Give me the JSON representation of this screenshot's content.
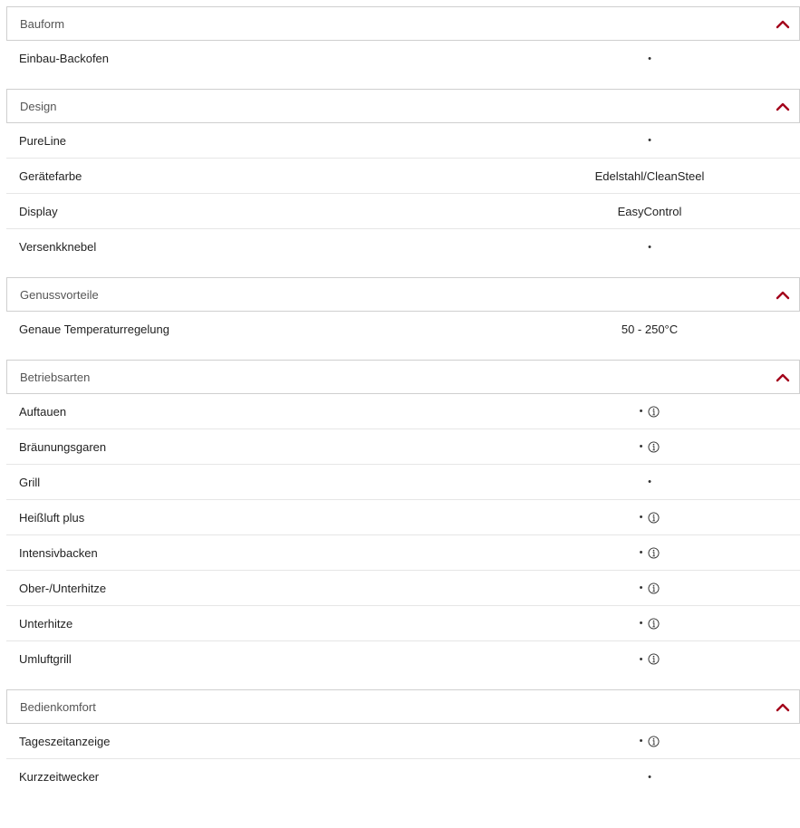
{
  "sections": [
    {
      "title": "Bauform",
      "rows": [
        {
          "label": "Einbau-Backofen",
          "value": "•",
          "info": false
        }
      ]
    },
    {
      "title": "Design",
      "rows": [
        {
          "label": "PureLine",
          "value": "•",
          "info": false
        },
        {
          "label": "Gerätefarbe",
          "value": "Edelstahl/CleanSteel",
          "info": false
        },
        {
          "label": "Display",
          "value": "EasyControl",
          "info": false
        },
        {
          "label": "Versenkknebel",
          "value": "•",
          "info": false
        }
      ]
    },
    {
      "title": "Genussvorteile",
      "rows": [
        {
          "label": "Genaue Temperaturregelung",
          "value": "50 - 250°C",
          "info": false
        }
      ]
    },
    {
      "title": "Betriebsarten",
      "rows": [
        {
          "label": "Auftauen",
          "value": "•",
          "info": true
        },
        {
          "label": "Bräunungsgaren",
          "value": "•",
          "info": true
        },
        {
          "label": "Grill",
          "value": "•",
          "info": false
        },
        {
          "label": "Heißluft plus",
          "value": "•",
          "info": true
        },
        {
          "label": "Intensivbacken",
          "value": "•",
          "info": true
        },
        {
          "label": "Ober-/Unterhitze",
          "value": "•",
          "info": true
        },
        {
          "label": "Unterhitze",
          "value": "•",
          "info": true
        },
        {
          "label": "Umluftgrill",
          "value": "•",
          "info": true
        }
      ]
    },
    {
      "title": "Bedienkomfort",
      "rows": [
        {
          "label": "Tageszeitanzeige",
          "value": "•",
          "info": true
        },
        {
          "label": "Kurzzeitwecker",
          "value": "•",
          "info": false
        }
      ]
    }
  ],
  "colors": {
    "accent": "#a3001b",
    "border": "#cfcfcf",
    "divider": "#e6e6e6"
  },
  "icons": {
    "collapse": "chevron-up-icon",
    "info": "info-circle-icon"
  }
}
